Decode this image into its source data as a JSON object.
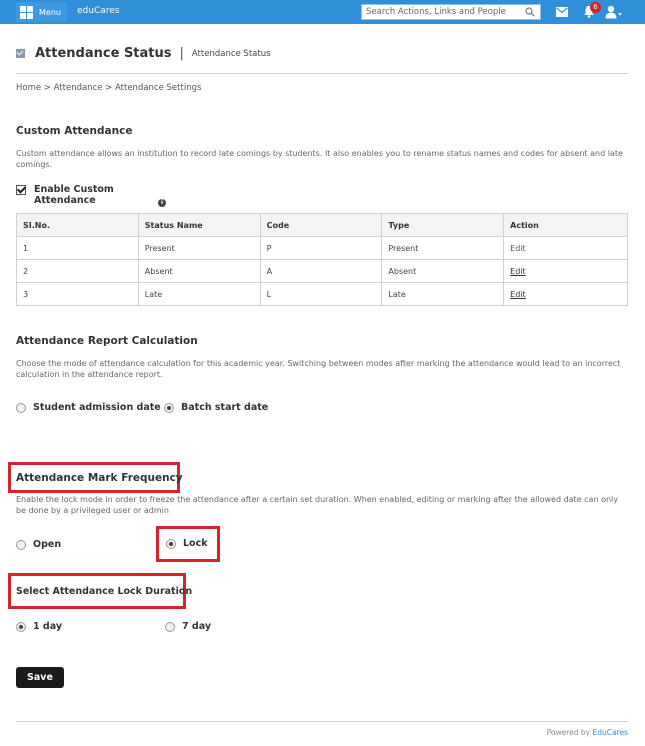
{
  "topbar": {
    "menu_label": "Menu",
    "brand": "eduCares",
    "search_placeholder": "Search Actions, Links and People",
    "notification_count": "6"
  },
  "header": {
    "title": "Attendance Status",
    "subtitle": "Attendance Status"
  },
  "breadcrumb": "Home > Attendance > Attendance Settings",
  "custom_attendance": {
    "title": "Custom Attendance",
    "description": "Custom attendance allows an institution to record late comings by students. It also enables you to rename status names and codes for absent and late comings.",
    "enable_label": "Enable Custom Attendance",
    "enabled": true,
    "table": {
      "headers": [
        "SI.No.",
        "Status Name",
        "Code",
        "Type",
        "Action"
      ],
      "rows": [
        [
          "1",
          "Present",
          "P",
          "Present",
          "Edit"
        ],
        [
          "2",
          "Absent",
          "A",
          "Absent",
          "Edit"
        ],
        [
          "3",
          "Late",
          "L",
          "Late",
          "Edit"
        ]
      ]
    }
  },
  "report_calculation": {
    "title": "Attendance Report Calculation",
    "description": "Choose the mode of attendance calculation for this academic year. Switching between modes after marking the attendance would lead to an incorrect calculation in the attendance report.",
    "options": [
      "Student admission date",
      "Batch start date"
    ],
    "selected": "Batch start date"
  },
  "mark_frequency": {
    "title": "Attendance Mark Frequency",
    "description": "Enable the lock mode in order to freeze the attendance after a certain set duration. When enabled, editing or marking after the allowed date can only be done by a privileged user or admin",
    "options": [
      "Open",
      "Lock"
    ],
    "selected": "Lock"
  },
  "lock_duration": {
    "title": "Select Attendance Lock Duration",
    "options": [
      "1 day",
      "7 day"
    ],
    "selected": "1 day"
  },
  "save_label": "Save",
  "footer": {
    "powered_by": "Powered by",
    "brand": "EduCares"
  },
  "colors": {
    "topbar": "#2f8fd8",
    "highlight": "#d6242b",
    "save_button": "#1b1b1b"
  }
}
